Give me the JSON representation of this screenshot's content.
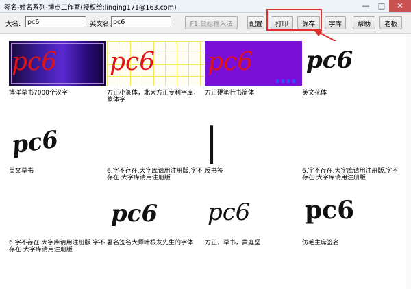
{
  "window": {
    "title": "签名-姓名系列-博点工作室(授权给:linqing171@163.com)",
    "minimize": "—",
    "maximize": "□",
    "close": "✕"
  },
  "toolbar": {
    "name_label": "大名:",
    "name_value": "pc6",
    "en_name_label": "英文名:",
    "en_name_value": "pc6",
    "mouse_input_button": "F1:鼠标输入法",
    "config_button": "配置",
    "print_button": "打印",
    "save_button": "保存",
    "font_lib_button": "字库",
    "help_button": "帮助",
    "old_version_button": "老板"
  },
  "signatures": [
    {
      "text": "pc6",
      "caption": "博洋草书7000个汉字",
      "style": "purple-bg",
      "color": "#e01414"
    },
    {
      "text": "pc6",
      "caption": "方正小篆体，北大方正专利字库，篆体字",
      "style": "grid",
      "color": "#e01414"
    },
    {
      "text": "pc6",
      "caption": "方正硬笔行书简体",
      "style": "violet-bg",
      "color": "#e01414"
    },
    {
      "text": "pc6",
      "caption": "英文花体",
      "style": "plain",
      "color": "#111111"
    },
    {
      "text": "pc6",
      "caption": "英文草书",
      "style": "plain",
      "color": "#111111"
    },
    {
      "text": "",
      "caption": "6.字不存在.大字库请用注册版.字不存在.大字库请用注册版",
      "style": "blank",
      "color": "#111111"
    },
    {
      "text": "|",
      "caption": "反书签",
      "style": "plain",
      "color": "#111111"
    },
    {
      "text": "",
      "caption": "6.字不存在.大字库请用注册版.字不存在.大字库请用注册版",
      "style": "blank",
      "color": "#111111"
    },
    {
      "text": "",
      "caption": "6.字不存在.大字库请用注册版.字不存在.大字库请用注册版",
      "style": "blank",
      "color": "#111111"
    },
    {
      "text": "pc6",
      "caption": "著名签名大师叶根友先生的字体",
      "style": "plain",
      "color": "#111111"
    },
    {
      "text": "pc6",
      "caption": "方正，草书，黄庭坚",
      "style": "plain",
      "color": "#111111"
    },
    {
      "text": "pc6",
      "caption": "仿毛主席签名",
      "style": "plain",
      "color": "#111111"
    }
  ]
}
